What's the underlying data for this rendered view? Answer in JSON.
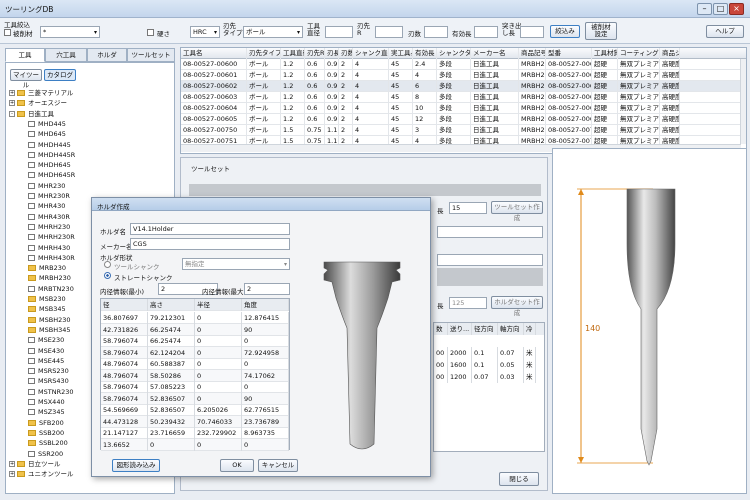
{
  "window": {
    "title": "ツーリングDB"
  },
  "filter": {
    "section_label": "工具絞込",
    "check1_label": "被削材",
    "check1_value": "*",
    "check2_label": "硬さ",
    "hardness_value": "HRC",
    "tip_type_label": "刃先\nタイプ",
    "tip_type_value": "ボール",
    "tool_dia_label": "工具\n直径",
    "tip_r_label": "刃先\nR",
    "flutes_label": "刃数",
    "effective_len_label": "有効長",
    "protrusion_label": "突き出\nし長",
    "narrow_button": "絞込み",
    "material_settings_button": "被削材\n設定",
    "help_button": "ヘルプ"
  },
  "tabs": [
    "工具",
    "穴工具",
    "ホルダ",
    "ツールセット"
  ],
  "tree_buttons": {
    "my_tool": "マイツール",
    "catalog": "カタログ"
  },
  "tree": [
    {
      "label": "三菱マテリアル",
      "kind": "root",
      "expander": "+"
    },
    {
      "label": "オーエスジー",
      "kind": "root",
      "expander": "+"
    },
    {
      "label": "日進工具",
      "kind": "root",
      "expander": "-"
    },
    {
      "label": "MHD445",
      "kind": "doc"
    },
    {
      "label": "MHD645",
      "kind": "doc"
    },
    {
      "label": "MHDH445",
      "kind": "doc"
    },
    {
      "label": "MHDH445R",
      "kind": "doc"
    },
    {
      "label": "MHDH645",
      "kind": "doc"
    },
    {
      "label": "MHDH645R",
      "kind": "doc"
    },
    {
      "label": "MHR230",
      "kind": "doc"
    },
    {
      "label": "MHR230R",
      "kind": "doc"
    },
    {
      "label": "MHR430",
      "kind": "doc"
    },
    {
      "label": "MHR430R",
      "kind": "doc"
    },
    {
      "label": "MHRH230",
      "kind": "doc"
    },
    {
      "label": "MHRH230R",
      "kind": "doc"
    },
    {
      "label": "MHRH430",
      "kind": "doc"
    },
    {
      "label": "MHRH430R",
      "kind": "doc"
    },
    {
      "label": "MRB230",
      "kind": "folder"
    },
    {
      "label": "MRBH230",
      "kind": "folder"
    },
    {
      "label": "MRBTN230",
      "kind": "doc"
    },
    {
      "label": "MSB230",
      "kind": "folder"
    },
    {
      "label": "MSB345",
      "kind": "folder"
    },
    {
      "label": "MSBH230",
      "kind": "folder"
    },
    {
      "label": "MSBH345",
      "kind": "folder"
    },
    {
      "label": "MSE230",
      "kind": "doc"
    },
    {
      "label": "MSE430",
      "kind": "doc"
    },
    {
      "label": "MSE445",
      "kind": "doc"
    },
    {
      "label": "MSRS230",
      "kind": "doc"
    },
    {
      "label": "MSRS430",
      "kind": "doc"
    },
    {
      "label": "MSTNR230",
      "kind": "doc"
    },
    {
      "label": "MSX440",
      "kind": "doc"
    },
    {
      "label": "MSZ345",
      "kind": "doc"
    },
    {
      "label": "SFB200",
      "kind": "folder"
    },
    {
      "label": "SSB200",
      "kind": "folder"
    },
    {
      "label": "SSBL200",
      "kind": "folder"
    },
    {
      "label": "SSR200",
      "kind": "doc"
    },
    {
      "label": "日立ツール",
      "kind": "root",
      "expander": "+"
    },
    {
      "label": "ユニオンツール",
      "kind": "root",
      "expander": "+"
    }
  ],
  "grid": {
    "headers": [
      "工具名",
      "刃先タイプ",
      "工具直径",
      "刃先R",
      "刃長",
      "刃数",
      "シャンク直径",
      "実工具長",
      "有効長",
      "シャンクタイプ",
      "メーカー名",
      "商品記号",
      "型番",
      "工具材質",
      "コーティング",
      "商品シ"
    ],
    "rows": [
      [
        "08-00527-00600",
        "ボール",
        "1.2",
        "0.6",
        "0.9",
        "2",
        "4",
        "45",
        "2.4",
        "多段",
        "日進工具",
        "MRBH230",
        "08-00527-00600",
        "超硬",
        "無双プレミアム",
        "高硬度"
      ],
      [
        "08-00527-00601",
        "ボール",
        "1.2",
        "0.6",
        "0.9",
        "2",
        "4",
        "45",
        "4",
        "多段",
        "日進工具",
        "MRBH230",
        "08-00527-00601",
        "超硬",
        "無双プレミアム",
        "高硬度"
      ],
      [
        "08-00527-00602",
        "ボール",
        "1.2",
        "0.6",
        "0.9",
        "2",
        "4",
        "45",
        "6",
        "多段",
        "日進工具",
        "MRBH230",
        "08-00527-00602",
        "超硬",
        "無双プレミアム",
        "高硬度"
      ],
      [
        "08-00527-00603",
        "ボール",
        "1.2",
        "0.6",
        "0.9",
        "2",
        "4",
        "45",
        "8",
        "多段",
        "日進工具",
        "MRBH230",
        "08-00527-00603",
        "超硬",
        "無双プレミアム",
        "高硬度"
      ],
      [
        "08-00527-00604",
        "ボール",
        "1.2",
        "0.6",
        "0.9",
        "2",
        "4",
        "45",
        "10",
        "多段",
        "日進工具",
        "MRBH230",
        "08-00527-00604",
        "超硬",
        "無双プレミアム",
        "高硬度"
      ],
      [
        "08-00527-00605",
        "ボール",
        "1.2",
        "0.6",
        "0.9",
        "2",
        "4",
        "45",
        "12",
        "多段",
        "日進工具",
        "MRBH230",
        "08-00527-00605",
        "超硬",
        "無双プレミアム",
        "高硬度"
      ],
      [
        "08-00527-00750",
        "ボール",
        "1.5",
        "0.75",
        "1.1",
        "2",
        "4",
        "45",
        "3",
        "多段",
        "日進工具",
        "MRBH230",
        "08-00527-00750",
        "超硬",
        "無双プレミアム",
        "高硬度"
      ],
      [
        "08-00527-00751",
        "ボール",
        "1.5",
        "0.75",
        "1.1",
        "2",
        "4",
        "45",
        "4",
        "多段",
        "日進工具",
        "MRBH230",
        "08-00527-00751",
        "超硬",
        "無双プレミアム",
        "高硬度"
      ]
    ]
  },
  "toolset": {
    "title": "ツールセット",
    "len_label": "長",
    "len_value": "15",
    "create_button": "ツールセット作成",
    "holder_len_label": "長",
    "holder_len_value": "125",
    "holder_create_button": "ホルダセット作成",
    "cond_headers": [
      "数",
      "送り...",
      "径方向",
      "軸方向",
      "冷"
    ],
    "cond_rows": [
      [
        "00",
        "2000",
        "0.1",
        "0.07",
        "米"
      ],
      [
        "00",
        "1600",
        "0.1",
        "0.05",
        "米"
      ],
      [
        "00",
        "1200",
        "0.07",
        "0.03",
        "米"
      ]
    ],
    "close_button": "閉じる"
  },
  "preview": {
    "dimension_label": "140"
  },
  "dialog": {
    "title": "ホルダ作成",
    "holder_name_label": "ホルダ名",
    "holder_name_value": "V14.1Holder",
    "maker_label": "メーカー名",
    "maker_value": "CGS",
    "shape_label": "ホルダ形状",
    "radio1": "ツールシャンク",
    "radio1_select": "無指定",
    "radio2": "ストレートシャンク",
    "inner_min_label": "内径情報(最小)",
    "inner_min_value": "2",
    "inner_max_label": "内径情報(最大)",
    "inner_max_value": "2",
    "table_headers": [
      "径",
      "高さ",
      "半径",
      "角度"
    ],
    "table_rows": [
      [
        "36.807697",
        "79.212301",
        "0",
        "12.876415"
      ],
      [
        "42.731826",
        "66.25474",
        "0",
        "90"
      ],
      [
        "58.796074",
        "66.25474",
        "0",
        "0"
      ],
      [
        "58.796074",
        "62.124204",
        "0",
        "72.924958"
      ],
      [
        "48.796074",
        "60.588387",
        "0",
        "0"
      ],
      [
        "48.796074",
        "58.50286",
        "0",
        "74.17062"
      ],
      [
        "58.796074",
        "57.085223",
        "0",
        "0"
      ],
      [
        "58.796074",
        "52.836507",
        "0",
        "90"
      ],
      [
        "54.569669",
        "52.836507",
        "6.205026",
        "62.776515"
      ],
      [
        "44.473128",
        "50.239432",
        "70.746033",
        "23.736789"
      ],
      [
        "21.147127",
        "23.716659",
        "232.729902",
        "8.963735"
      ],
      [
        "13.6652",
        "0",
        "0",
        "0"
      ]
    ],
    "read_button": "図形読み込み",
    "ok_button": "OK",
    "cancel_button": "キャンセル"
  }
}
